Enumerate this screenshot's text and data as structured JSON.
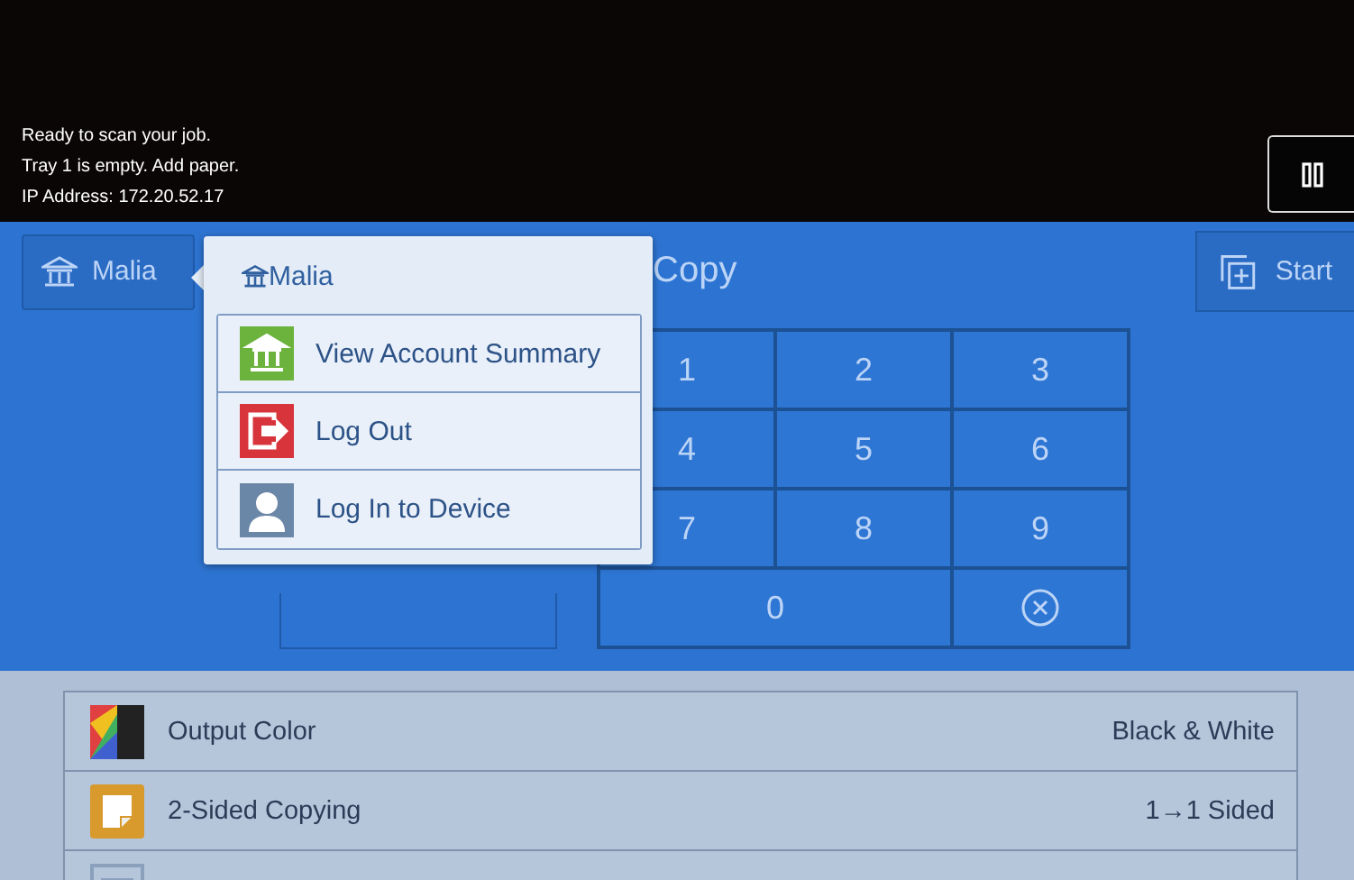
{
  "status_messages": [
    "Ready to scan your job.",
    "Tray 1 is empty.  Add paper.",
    "IP Address: 172.20.52.17"
  ],
  "account_button": {
    "label": "Malia"
  },
  "app_title": "Copy",
  "start_button": {
    "label": "Start"
  },
  "keypad": [
    {
      "label": "1",
      "kind": "digit"
    },
    {
      "label": "2",
      "kind": "digit"
    },
    {
      "label": "3",
      "kind": "digit"
    },
    {
      "label": "4",
      "kind": "digit"
    },
    {
      "label": "5",
      "kind": "digit"
    },
    {
      "label": "6",
      "kind": "digit"
    },
    {
      "label": "7",
      "kind": "digit"
    },
    {
      "label": "8",
      "kind": "digit"
    },
    {
      "label": "9",
      "kind": "digit"
    },
    {
      "label": "0",
      "kind": "wide"
    },
    {
      "kind": "clear"
    }
  ],
  "account_menu": {
    "title": "Malia",
    "items": [
      {
        "label": "View Account Summary",
        "kind": "account"
      },
      {
        "label": "Log Out",
        "kind": "logout"
      },
      {
        "label": "Log In to Device",
        "kind": "login"
      }
    ]
  },
  "features": [
    {
      "label": "Output Color",
      "value": "Black & White",
      "kind": "color"
    },
    {
      "label": "2-Sided Copying",
      "value": "1→1 Sided",
      "kind": "sided"
    },
    {
      "kind": "paper"
    }
  ]
}
